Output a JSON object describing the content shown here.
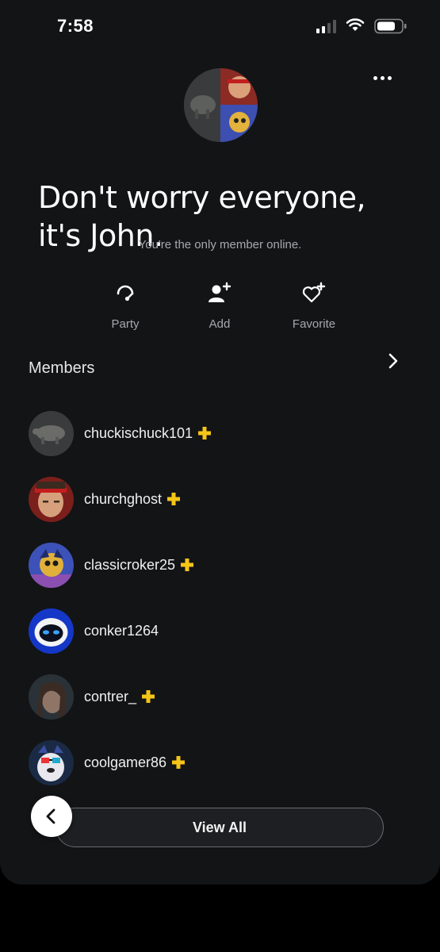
{
  "status_bar": {
    "time": "7:58",
    "icons": [
      "signal-icon",
      "wifi-icon",
      "battery-icon"
    ]
  },
  "header": {
    "menu_icon": "more-horizontal-icon"
  },
  "group": {
    "title": "Don't worry everyone, it's John.",
    "online_note": "You're the only member online."
  },
  "actions": [
    {
      "label": "Party",
      "icon": "headset-icon"
    },
    {
      "label": "Add",
      "icon": "add-person-icon"
    },
    {
      "label": "Favorite",
      "icon": "heart-plus-icon"
    }
  ],
  "members_section": {
    "heading": "Members"
  },
  "members": [
    {
      "name": "chuckischuck101",
      "plus": true
    },
    {
      "name": "churchghost",
      "plus": true
    },
    {
      "name": "classicroker25",
      "plus": true
    },
    {
      "name": "conker1264",
      "plus": false
    },
    {
      "name": "contrer_",
      "plus": true
    },
    {
      "name": "coolgamer86",
      "plus": true
    }
  ],
  "footer": {
    "view_all_label": "View All"
  },
  "colors": {
    "background": "#131416",
    "plus_badge": "#f5c518",
    "secondary_text": "#a7a8ab"
  }
}
